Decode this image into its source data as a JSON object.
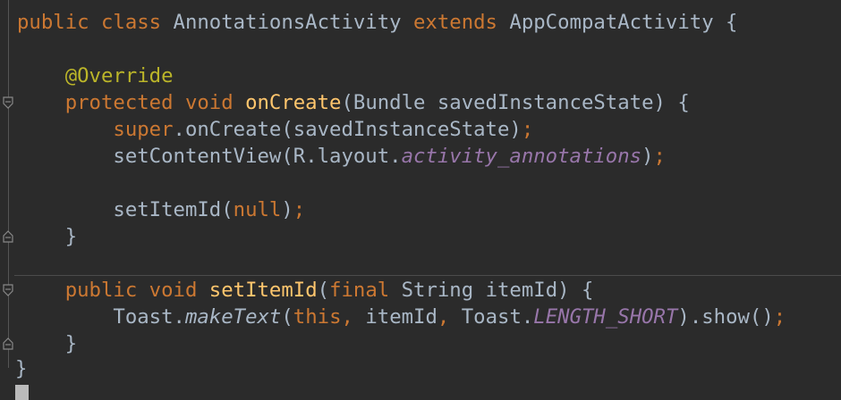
{
  "code": {
    "l1": {
      "t1": "public class ",
      "t2": "AnnotationsActivity ",
      "t3": "extends ",
      "t4": "AppCompatActivity {"
    },
    "l3": {
      "indent": "    ",
      "t1": "@Override"
    },
    "l4": {
      "indent": "    ",
      "t1": "protected void ",
      "t2": "onCreate",
      "t3": "(Bundle savedInstanceState) {"
    },
    "l5": {
      "indent": "        ",
      "t1": "super",
      "t2": ".onCreate(savedInstanceState)",
      "t3": ";"
    },
    "l6": {
      "indent": "        ",
      "t1": "setContentView(R.layout.",
      "t2": "activity_annotations",
      "t3": ")",
      "t4": ";"
    },
    "l8": {
      "indent": "        ",
      "t1": "setItemId(",
      "t2": "null",
      "t3": ")",
      "t4": ";"
    },
    "l9": {
      "indent": "    ",
      "t1": "}"
    },
    "l11": {
      "indent": "    ",
      "t1": "public void ",
      "t2": "setItemId",
      "t3": "(",
      "t4": "final ",
      "t5": "String itemId) {"
    },
    "l12": {
      "indent": "        ",
      "t1": "Toast.",
      "t2": "makeText",
      "t3": "(",
      "t4": "this, ",
      "t5": "itemId",
      "t6": ", ",
      "t7": "Toast.",
      "t8": "LENGTH_SHORT",
      "t9": ").show()",
      "t10": ";"
    },
    "l13": {
      "indent": "    ",
      "t1": "}"
    },
    "l14": {
      "t1": "}"
    }
  },
  "colors": {
    "background": "#2b2b2b",
    "keyword": "#cc7832",
    "annotation": "#bbb529",
    "method_declaration": "#ffc66d",
    "plain_text": "#a9b7c6",
    "field": "#9876aa",
    "caret": "#bbbbbb"
  },
  "icons": {
    "fold_open": "fold-marker-icon",
    "fold_close": "fold-end-icon"
  }
}
